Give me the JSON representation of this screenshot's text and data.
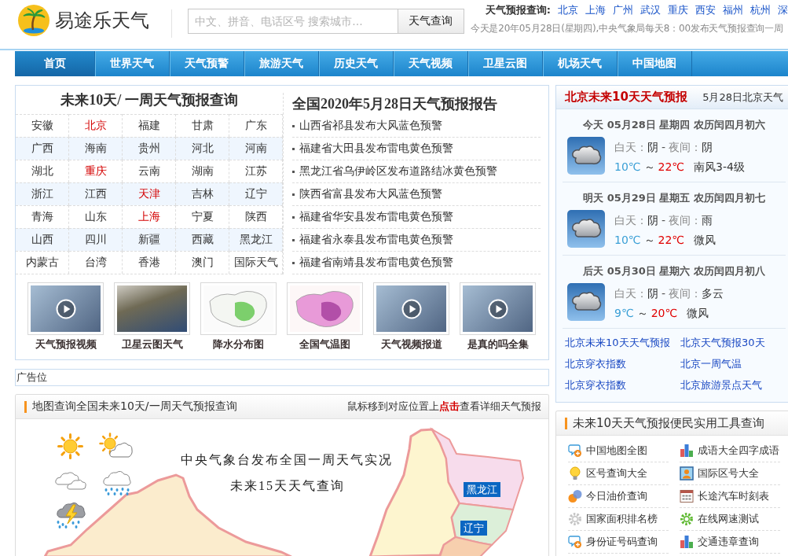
{
  "header": {
    "logo_text": "易途乐天气",
    "search": {
      "placeholder": "中文、拼音、电话区号 搜索城市...",
      "button": "天气查询"
    },
    "quick_label": "天气预报查询:",
    "quick_cities": [
      "北京",
      "上海",
      "广州",
      "武汉",
      "重庆",
      "西安",
      "福州",
      "杭州",
      "深"
    ],
    "notice": "今天是20年05月28日(星期四),中央气象局每天8：00发布天气预报查询一周"
  },
  "nav": [
    {
      "label": "首页",
      "selected": true
    },
    {
      "label": "世界天气",
      "selected": false
    },
    {
      "label": "天气预警",
      "selected": false
    },
    {
      "label": "旅游天气",
      "selected": false
    },
    {
      "label": "历史天气",
      "selected": false
    },
    {
      "label": "天气视频",
      "selected": false
    },
    {
      "label": "卫星云图",
      "selected": false
    },
    {
      "label": "机场天气",
      "selected": false
    },
    {
      "label": "中国地图",
      "selected": false
    }
  ],
  "city_panel": {
    "title": "未来10天/ 一周天气预报查询",
    "cities": [
      {
        "name": "安徽",
        "highlighted": false
      },
      {
        "name": "北京",
        "highlighted": true
      },
      {
        "name": "福建",
        "highlighted": false
      },
      {
        "name": "甘肃",
        "highlighted": false
      },
      {
        "name": "广东",
        "highlighted": false
      },
      {
        "name": "广西",
        "highlighted": false
      },
      {
        "name": "海南",
        "highlighted": false
      },
      {
        "name": "贵州",
        "highlighted": false
      },
      {
        "name": "河北",
        "highlighted": false
      },
      {
        "name": "河南",
        "highlighted": false
      },
      {
        "name": "湖北",
        "highlighted": false
      },
      {
        "name": "重庆",
        "highlighted": true
      },
      {
        "name": "云南",
        "highlighted": false
      },
      {
        "name": "湖南",
        "highlighted": false
      },
      {
        "name": "江苏",
        "highlighted": false
      },
      {
        "name": "浙江",
        "highlighted": false
      },
      {
        "name": "江西",
        "highlighted": false
      },
      {
        "name": "天津",
        "highlighted": true
      },
      {
        "name": "吉林",
        "highlighted": false
      },
      {
        "name": "辽宁",
        "highlighted": false
      },
      {
        "name": "青海",
        "highlighted": false
      },
      {
        "name": "山东",
        "highlighted": false
      },
      {
        "name": "上海",
        "highlighted": true
      },
      {
        "name": "宁夏",
        "highlighted": false
      },
      {
        "name": "陕西",
        "highlighted": false
      },
      {
        "name": "山西",
        "highlighted": false
      },
      {
        "name": "四川",
        "highlighted": false
      },
      {
        "name": "新疆",
        "highlighted": false
      },
      {
        "name": "西藏",
        "highlighted": false
      },
      {
        "name": "黑龙江",
        "highlighted": false
      },
      {
        "name": "内蒙古",
        "highlighted": false
      },
      {
        "name": "台湾",
        "highlighted": false
      },
      {
        "name": "香港",
        "highlighted": false
      },
      {
        "name": "澳门",
        "highlighted": false
      },
      {
        "name": "国际天气",
        "highlighted": false
      }
    ]
  },
  "report": {
    "title": "全国2020年5月28日天气预报报告",
    "items": [
      "山西省祁县发布大风蓝色预警",
      "福建省大田县发布雷电黄色预警",
      "黑龙江省乌伊岭区发布道路结冰黄色预警",
      "陕西省富县发布大风蓝色预警",
      "福建省华安县发布雷电黄色预警",
      "福建省永泰县发布雷电黄色预警",
      "福建省南靖县发布雷电黄色预警"
    ]
  },
  "thumbnails": [
    {
      "caption": "天气预报视频",
      "kind": "video"
    },
    {
      "caption": "卫星云图天气",
      "kind": "satellite"
    },
    {
      "caption": "降水分布图",
      "kind": "map"
    },
    {
      "caption": "全国气温图",
      "kind": "heatmap"
    },
    {
      "caption": "天气视频报道",
      "kind": "video"
    },
    {
      "caption": "是真的吗全集",
      "kind": "video"
    }
  ],
  "ad": "广告位",
  "map_section": {
    "title": "地图查询全国未来10天/一周天气预报查询",
    "hint": "鼠标移到对应位置上**点击**查看详细天气预报",
    "headline": "中央气象台发布全国一周天气实况",
    "subheadline": "未来15天天气查询",
    "labels": [
      "黑龙江",
      "辽宁"
    ]
  },
  "forecast": {
    "title": "北京未来10天天气预报",
    "date_link": "5月28日北京天气",
    "days": [
      {
        "heading": "今天 05月28日 星期四 农历闰四月初六",
        "day_label": "白天：",
        "day": "阴",
        "dash": "-",
        "night_label": "夜间：",
        "night": "阴",
        "low": "10℃",
        "tilde": "～",
        "high": "22℃",
        "wind": "南风3-4级"
      },
      {
        "heading": "明天 05月29日 星期五 农历闰四月初七",
        "day_label": "白天：",
        "day": "阴",
        "dash": "-",
        "night_label": "夜间：",
        "night": "雨",
        "low": "10℃",
        "tilde": "～",
        "high": "22℃",
        "wind": "微风"
      },
      {
        "heading": "后天 05月30日 星期六 农历闰四月初八",
        "day_label": "白天：",
        "day": "阴",
        "dash": "-",
        "night_label": "夜间：",
        "night": "多云",
        "low": "9℃",
        "tilde": "～",
        "high": "20℃",
        "wind": "微风"
      }
    ],
    "links": [
      "北京未来10天天气预报",
      "北京天气预报30天",
      "北京穿衣指数",
      "北京一周气温",
      "北京穿衣指数",
      "北京旅游景点天气"
    ]
  },
  "tools": {
    "title": "未来10天天气预报便民实用工具查询",
    "items": [
      {
        "label": "中国地图全图",
        "kind": "bubble"
      },
      {
        "label": "成语大全四字成语",
        "kind": "chart"
      },
      {
        "label": "区号查询大全",
        "kind": "bulb"
      },
      {
        "label": "国际区号大全",
        "kind": "portrait"
      },
      {
        "label": "今日油价查询",
        "kind": "blobs"
      },
      {
        "label": "长途汽车时刻表",
        "kind": "calendar"
      },
      {
        "label": "国家面积排名榜",
        "kind": "gear"
      },
      {
        "label": "在线网速测试",
        "kind": "cog"
      },
      {
        "label": "身份证号码查询",
        "kind": "bubble"
      },
      {
        "label": "交通违章查询",
        "kind": "chart"
      }
    ]
  }
}
